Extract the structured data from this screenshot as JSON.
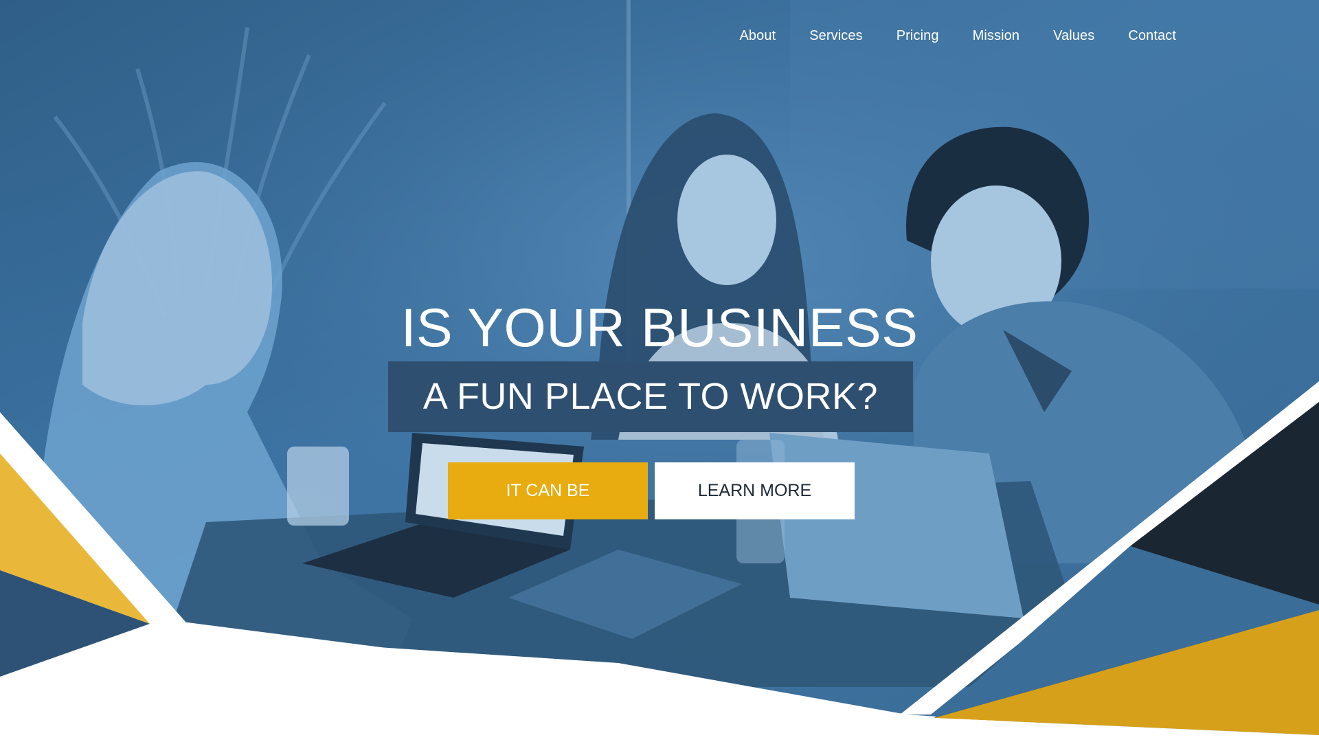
{
  "nav": {
    "items": [
      {
        "label": "About"
      },
      {
        "label": "Services"
      },
      {
        "label": "Pricing"
      },
      {
        "label": "Mission"
      },
      {
        "label": "Values"
      },
      {
        "label": "Contact"
      }
    ]
  },
  "hero": {
    "headline_line1": "IS YOUR BUSINESS",
    "headline_line2": "A FUN PLACE TO WORK?",
    "primary_button": "IT CAN BE",
    "secondary_button": "LEARN MORE",
    "photo_subject": "three-people-laughing-around-laptops",
    "photo_tint": "#3f77a8"
  },
  "colors": {
    "accent_yellow": "#e8ac10",
    "navy": "#2f4f70",
    "steel_blue": "#3a6d97",
    "dark_navy": "#1b2633",
    "white": "#ffffff"
  }
}
